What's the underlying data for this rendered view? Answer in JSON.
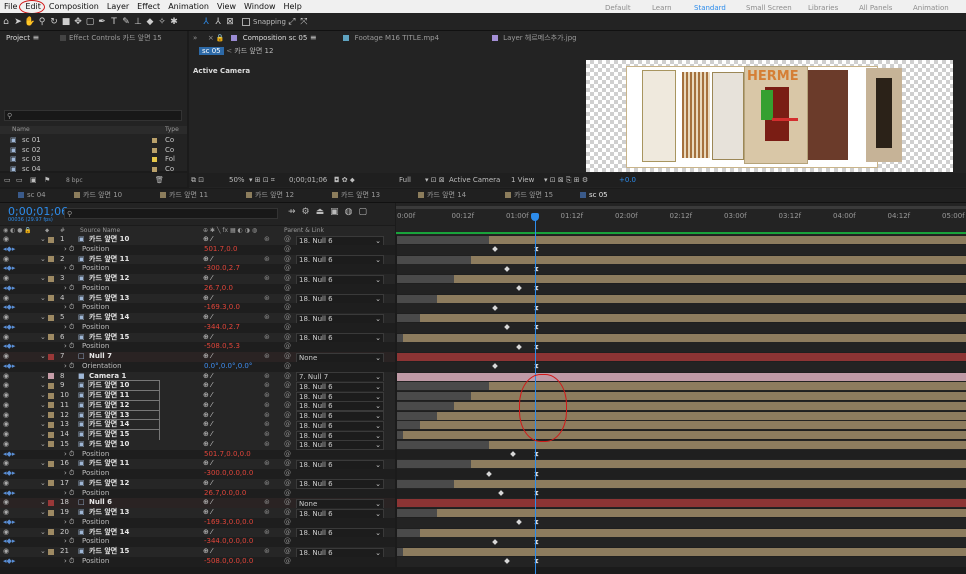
{
  "menu": [
    "File",
    "Edit",
    "Composition",
    "Layer",
    "Effect",
    "Animation",
    "View",
    "Window",
    "Help"
  ],
  "toolbar": {
    "snapping_label": "Snapping",
    "workspaces": [
      "Default",
      "Learn",
      "Standard",
      "Small Screen",
      "Libraries",
      "All Panels",
      "Animation"
    ],
    "active_workspace": "Standard"
  },
  "project": {
    "tabs": [
      "Project",
      "Effect Controls 카드 앞면 15"
    ],
    "col_name": "Name",
    "col_type": "Type",
    "items": [
      {
        "name": "sc 01",
        "type": "Co"
      },
      {
        "name": "sc 02",
        "type": "Co"
      },
      {
        "name": "sc 03",
        "type": "Fol"
      },
      {
        "name": "sc 04",
        "type": "Co"
      }
    ],
    "bpc": "8 bpc"
  },
  "viewer": {
    "tabs": [
      "Composition sc 05",
      "Footage M16 TITLE.mp4",
      "Layer 헤르메스추가.jpg"
    ],
    "crumbs": [
      "sc 05",
      "카드 앞면 12"
    ],
    "active_camera_label": "Active Camera",
    "zoom": "50%",
    "timecode": "0;00;01;06",
    "resolution": "Full",
    "camera_select": "Active Camera",
    "view_select": "1 View",
    "exposure": "+0.0"
  },
  "timeline": {
    "tabs": [
      "sc 04",
      "카드 앞면 10",
      "카드 앞면 11",
      "카드 앞면 12",
      "카드 앞면 13",
      "카드 앞면 14",
      "카드 앞면 15",
      "sc 05"
    ],
    "current_time": "0;00;01;06",
    "fps_info": "00036 (29.97 fps)",
    "col_source": "Source Name",
    "col_parent": "Parent & Link",
    "ruler": [
      "0:00f",
      "00:12f",
      "01:00f",
      "01:12f",
      "02:00f",
      "02:12f",
      "03:00f",
      "03:12f",
      "04:00f",
      "04:12f",
      "05:00f"
    ],
    "rows": [
      {
        "num": "1",
        "name": "카드 앞면 10",
        "parent": "18. Null 6",
        "kind": "layer",
        "color": "#9e8a63",
        "bar_start": 0.161
      },
      {
        "kind": "prop",
        "prop": "Position",
        "value": "501.7,0.0"
      },
      {
        "num": "2",
        "name": "카드 앞면 11",
        "parent": "18. Null 6",
        "kind": "layer",
        "color": "#9e8a63",
        "bar_start": 0.13
      },
      {
        "kind": "prop",
        "prop": "Position",
        "value": "-300.0,2.7"
      },
      {
        "num": "3",
        "name": "카드 앞면 12",
        "parent": "18. Null 6",
        "kind": "layer",
        "color": "#9e8a63",
        "bar_start": 0.1
      },
      {
        "kind": "prop",
        "prop": "Position",
        "value": "26.7,0.0"
      },
      {
        "num": "4",
        "name": "카드 앞면 13",
        "parent": "18. Null 6",
        "kind": "layer",
        "color": "#9e8a63",
        "bar_start": 0.07
      },
      {
        "kind": "prop",
        "prop": "Position",
        "value": "-169.3,0.0"
      },
      {
        "num": "5",
        "name": "카드 앞면 14",
        "parent": "18. Null 6",
        "kind": "layer",
        "color": "#9e8a63",
        "bar_start": 0.04
      },
      {
        "kind": "prop",
        "prop": "Position",
        "value": "-344.0,2.7"
      },
      {
        "num": "6",
        "name": "카드 앞면 15",
        "parent": "18. Null 6",
        "kind": "layer",
        "color": "#9e8a63",
        "bar_start": 0.01
      },
      {
        "kind": "prop",
        "prop": "Position",
        "value": "-508.0,5.3"
      },
      {
        "num": "7",
        "name": "Null 7",
        "parent": "None",
        "kind": "null",
        "color": "#9a3838",
        "bar_start": 0.0
      },
      {
        "kind": "prop",
        "prop": "Orientation",
        "value": "0.0°,0.0°,0.0°"
      },
      {
        "num": "8",
        "name": "Camera 1",
        "parent": "7. Null 7",
        "kind": "camera",
        "color": "#c79ea9",
        "bar_start": 0.0
      },
      {
        "num": "9",
        "name": "카드 앞면 10",
        "parent": "18. Null 6",
        "kind": "layer",
        "color": "#9e8a63",
        "bar_start": 0.161
      },
      {
        "num": "10",
        "name": "카드 앞면 11",
        "parent": "18. Null 6",
        "kind": "layer",
        "color": "#9e8a63",
        "bar_start": 0.13
      },
      {
        "num": "11",
        "name": "카드 앞면 12",
        "parent": "18. Null 6",
        "kind": "layer",
        "color": "#9e8a63",
        "bar_start": 0.1
      },
      {
        "num": "12",
        "name": "카드 앞면 13",
        "parent": "18. Null 6",
        "kind": "layer",
        "color": "#9e8a63",
        "bar_start": 0.07
      },
      {
        "num": "13",
        "name": "카드 앞면 14",
        "parent": "18. Null 6",
        "kind": "layer",
        "color": "#9e8a63",
        "bar_start": 0.04
      },
      {
        "num": "14",
        "name": "카드 앞면 15",
        "parent": "18. Null 6",
        "kind": "layer",
        "color": "#9e8a63",
        "bar_start": 0.01
      },
      {
        "num": "15",
        "name": "카드 앞면 10",
        "parent": "18. Null 6",
        "kind": "layer",
        "color": "#9e8a63",
        "bar_start": 0.161
      },
      {
        "kind": "prop",
        "prop": "Position",
        "value": "501.7,0.0,0.0"
      },
      {
        "num": "16",
        "name": "카드 앞면 11",
        "parent": "18. Null 6",
        "kind": "layer",
        "color": "#9e8a63",
        "bar_start": 0.13
      },
      {
        "kind": "prop",
        "prop": "Position",
        "value": "-300.0,0.0,0.0"
      },
      {
        "num": "17",
        "name": "카드 앞면 12",
        "parent": "18. Null 6",
        "kind": "layer",
        "color": "#9e8a63",
        "bar_start": 0.1
      },
      {
        "kind": "prop",
        "prop": "Position",
        "value": "26.7,0.0,0.0"
      },
      {
        "num": "18",
        "name": "Null 6",
        "parent": "None",
        "kind": "null",
        "color": "#9a3838",
        "bar_start": 0.0
      },
      {
        "num": "19",
        "name": "카드 앞면 13",
        "parent": "18. Null 6",
        "kind": "layer",
        "color": "#9e8a63",
        "bar_start": 0.07
      },
      {
        "kind": "prop",
        "prop": "Position",
        "value": "-169.3,0.0,0.0"
      },
      {
        "num": "20",
        "name": "카드 앞면 14",
        "parent": "18. Null 6",
        "kind": "layer",
        "color": "#9e8a63",
        "bar_start": 0.04
      },
      {
        "kind": "prop",
        "prop": "Position",
        "value": "-344.0,0.0,0.0"
      },
      {
        "num": "21",
        "name": "카드 앞면 15",
        "parent": "18. Null 6",
        "kind": "layer",
        "color": "#9e8a63",
        "bar_start": 0.01
      },
      {
        "kind": "prop",
        "prop": "Position",
        "value": "-508.0,0.0,0.0"
      }
    ]
  },
  "colors": {
    "accent": "#2d8ceb",
    "value_red": "#e0453a",
    "value_blue": "#3f8df0",
    "annotation": "#d21818"
  }
}
